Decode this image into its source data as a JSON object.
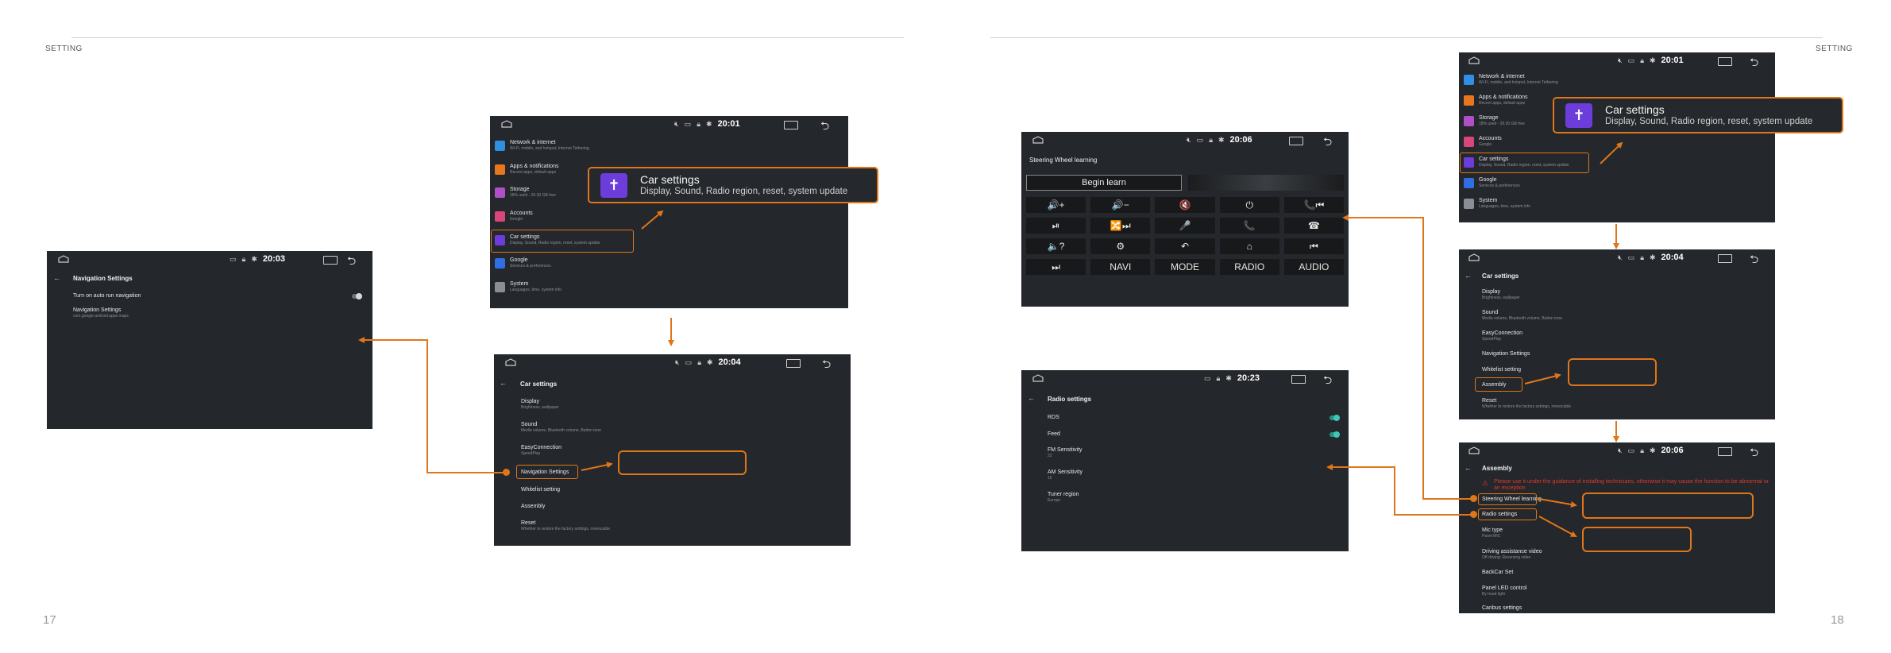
{
  "page": {
    "left_header": "SETTING",
    "right_header": "SETTING",
    "left_page_number": "17",
    "right_page_number": "18",
    "accent_color": "#e0761a"
  },
  "status": {
    "t_main": "20:01",
    "t_nav": "20:03",
    "t_car": "20:04",
    "t_sw": "20:06",
    "t_radio": "20:23",
    "t_r_main": "20:01",
    "t_r_car": "20:04",
    "t_r_asm": "20:06"
  },
  "main_menu": {
    "items": [
      {
        "title": "Network & internet",
        "sub": "Wi-Fi, mobile, and hotspot, Internet Tethering",
        "color": "#2f8fe3"
      },
      {
        "title": "Apps & notifications",
        "sub": "Recent apps, default apps",
        "color": "#e6771f"
      },
      {
        "title": "Storage",
        "sub": "18% used - 26.30 GB free",
        "color": "#b14fc8"
      },
      {
        "title": "Accounts",
        "sub": "Google",
        "color": "#d9477a"
      },
      {
        "title": "Car settings",
        "sub": "Display, Sound, Radio region, reset, system update",
        "color": "#6c3ddb"
      },
      {
        "title": "Google",
        "sub": "Services & preferences",
        "color": "#2f6fe3"
      },
      {
        "title": "System",
        "sub": "Languages, time, system info",
        "color": "#8b8f94"
      }
    ]
  },
  "callout": {
    "title": "Car settings",
    "subtitle": "Display, Sound, Radio region, reset, system update"
  },
  "car_settings": {
    "title": "Car settings",
    "items": [
      {
        "title": "Display",
        "sub": "Brightness, wallpaper"
      },
      {
        "title": "Sound",
        "sub": "Media volume, Bluetooth volume, Button tone"
      },
      {
        "title": "EasyConnection",
        "sub": "SpeedPlay"
      },
      {
        "title": "Navigation Settings",
        "sub": ""
      },
      {
        "title": "Whitelist setting",
        "sub": ""
      },
      {
        "title": "Assembly",
        "sub": ""
      },
      {
        "title": "Reset",
        "sub": "Whether to restore the factory settings, irrevocable"
      }
    ]
  },
  "nav_settings": {
    "title": "Navigation Settings",
    "auto_nav": "Turn on auto run navigation",
    "nav_item_title": "Navigation Settings",
    "nav_item_sub": "com.google.android.apps.maps"
  },
  "steering": {
    "title": "Steering Wheel learning",
    "begin": "Begin learn",
    "row1": [
      "🔊+",
      "🔊−",
      "🔇",
      "⏻",
      "📞⏮"
    ],
    "row2": [
      "⏯",
      "🔀⏭",
      "🎤",
      "📞",
      "☎"
    ],
    "row3": [
      "🔈?",
      "⚙",
      "↶",
      "⌂",
      "⏮"
    ],
    "row4": [
      "⏭",
      "NAVI",
      "MODE",
      "RADIO",
      "AUDIO"
    ]
  },
  "radio": {
    "title": "Radio settings",
    "items": [
      {
        "title": "RDS",
        "sub": ""
      },
      {
        "title": "Feed",
        "sub": ""
      },
      {
        "title": "FM Sensitivity",
        "sub": "22"
      },
      {
        "title": "AM Sensitivity",
        "sub": "16"
      },
      {
        "title": "Tuner region",
        "sub": "Europe"
      }
    ]
  },
  "assembly": {
    "title": "Assembly",
    "warning": "Please use it under the guidance of installing technicians, otherwise it may cause the function to be abnormal or an exception",
    "items": [
      {
        "title": "Steering Wheel learning",
        "sub": ""
      },
      {
        "title": "Radio settings",
        "sub": ""
      },
      {
        "title": "Mic type",
        "sub": "Panel MIC"
      },
      {
        "title": "Driving assistance video",
        "sub": "Off driving: Reversing video"
      },
      {
        "title": "BackCar Set",
        "sub": ""
      },
      {
        "title": "Panel LED control",
        "sub": "By head light"
      },
      {
        "title": "Canbus settings",
        "sub": ""
      }
    ]
  }
}
